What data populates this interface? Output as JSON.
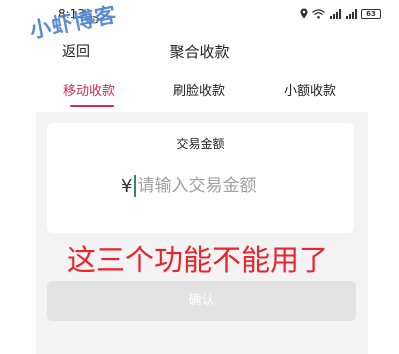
{
  "status_bar": {
    "time": "8:13",
    "battery": "63"
  },
  "watermark": {
    "text": "小虾博客"
  },
  "header": {
    "back_label": "返回",
    "title": "聚合收款"
  },
  "tabs": [
    {
      "label": "移动收款",
      "active": true
    },
    {
      "label": "刷脸收款",
      "active": false
    },
    {
      "label": "小额收款",
      "active": false
    }
  ],
  "amount_card": {
    "title": "交易金额",
    "currency": "¥",
    "placeholder": "请输入交易金额"
  },
  "annotation": {
    "text": "这三个功能不能用了"
  },
  "confirm_button": {
    "label": "确认"
  },
  "colors": {
    "accent": "#d6285e",
    "annotation": "#e8242d",
    "disabled_button": "#e3e3e3",
    "watermark": "#4a7fd1"
  }
}
